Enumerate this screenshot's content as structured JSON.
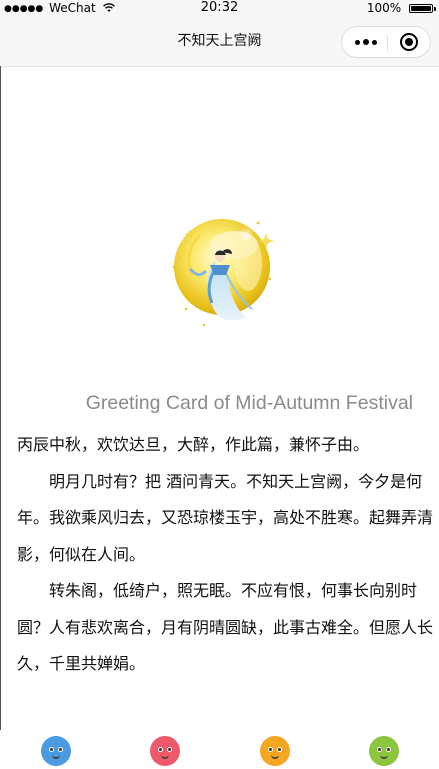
{
  "status": {
    "dots": "●●●●●",
    "carrier": "WeChat",
    "time": "20:32",
    "battery": "100%"
  },
  "nav": {
    "title": "不知天上宫阙"
  },
  "card": {
    "title": "Greeting Card of Mid-Autumn Festival"
  },
  "poem": {
    "preface": "丙辰中秋，欢饮达旦，大醉，作此篇，兼怀子由。",
    "stanza1": "明月几时有？把 酒问青天。不知天上宫阙，今夕是何年。我欲乘风归去，又恐琼楼玉宇，高处不胜寒。起舞弄清影，何似在人间。",
    "stanza2": "转朱阁，低绮户，照无眠。不应有恨，何事长向别时圆？人有悲欢离合，月有阴晴圆缺，此事古难全。但愿人长久，千里共婵娟。"
  },
  "tabs": [
    {
      "icon": "blue-creature-icon",
      "color": "#4a9be0"
    },
    {
      "icon": "red-creature-icon",
      "color": "#ee5a6a"
    },
    {
      "icon": "orange-creature-icon",
      "color": "#f5a623"
    },
    {
      "icon": "green-creature-icon",
      "color": "#8cc63f"
    }
  ]
}
